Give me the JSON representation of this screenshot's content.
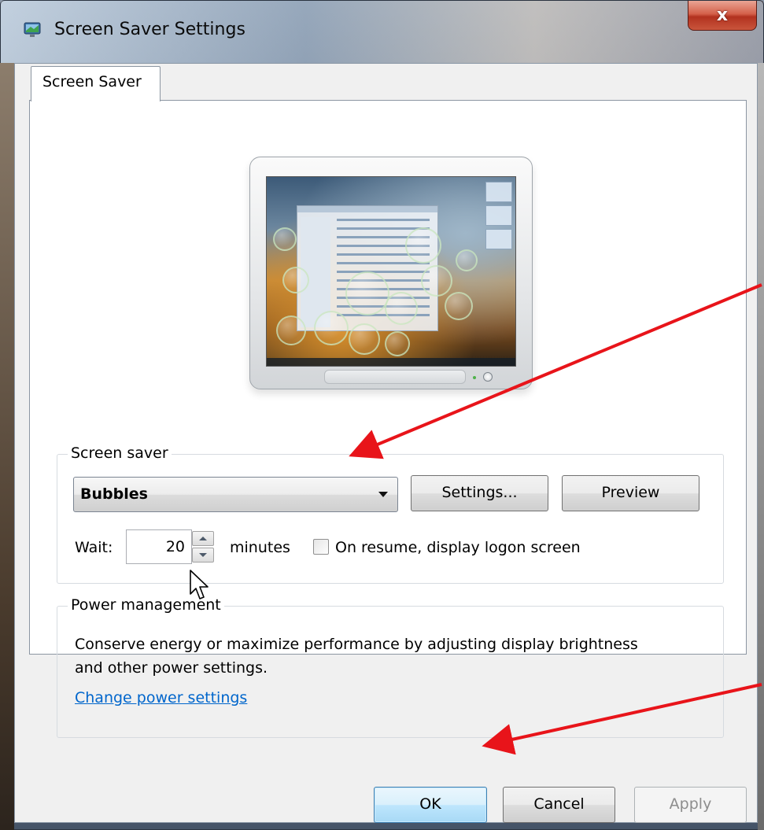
{
  "window": {
    "title": "Screen Saver Settings",
    "close_label": "x"
  },
  "tabs": [
    {
      "label": "Screen Saver"
    }
  ],
  "screen_saver_group": {
    "label": "Screen saver",
    "selected": "Bubbles",
    "settings_button": "Settings...",
    "preview_button": "Preview",
    "wait_label": "Wait:",
    "wait_value": "20",
    "minutes_label": "minutes",
    "resume_checkbox_label": "On resume, display logon screen",
    "resume_checked": false
  },
  "power_group": {
    "label": "Power management",
    "description": "Conserve energy or maximize performance by adjusting display brightness and other power settings.",
    "link": "Change power settings"
  },
  "buttons": {
    "ok": "OK",
    "cancel": "Cancel",
    "apply": "Apply"
  },
  "colors": {
    "annotation_arrow": "#e8141a",
    "link": "#0066cc",
    "default_button_border": "#3c7fb1"
  }
}
